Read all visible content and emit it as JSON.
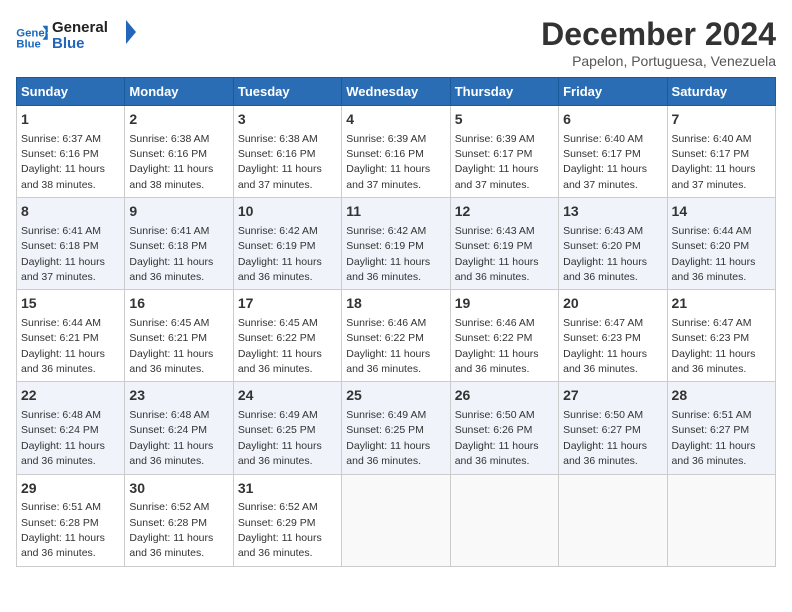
{
  "logo": {
    "line1": "General",
    "line2": "Blue"
  },
  "title": "December 2024",
  "location": "Papelon, Portuguesa, Venezuela",
  "days_header": [
    "Sunday",
    "Monday",
    "Tuesday",
    "Wednesday",
    "Thursday",
    "Friday",
    "Saturday"
  ],
  "weeks": [
    [
      {
        "day": "1",
        "sunrise": "6:37 AM",
        "sunset": "6:16 PM",
        "daylight": "11 hours and 38 minutes."
      },
      {
        "day": "2",
        "sunrise": "6:38 AM",
        "sunset": "6:16 PM",
        "daylight": "11 hours and 38 minutes."
      },
      {
        "day": "3",
        "sunrise": "6:38 AM",
        "sunset": "6:16 PM",
        "daylight": "11 hours and 37 minutes."
      },
      {
        "day": "4",
        "sunrise": "6:39 AM",
        "sunset": "6:16 PM",
        "daylight": "11 hours and 37 minutes."
      },
      {
        "day": "5",
        "sunrise": "6:39 AM",
        "sunset": "6:17 PM",
        "daylight": "11 hours and 37 minutes."
      },
      {
        "day": "6",
        "sunrise": "6:40 AM",
        "sunset": "6:17 PM",
        "daylight": "11 hours and 37 minutes."
      },
      {
        "day": "7",
        "sunrise": "6:40 AM",
        "sunset": "6:17 PM",
        "daylight": "11 hours and 37 minutes."
      }
    ],
    [
      {
        "day": "8",
        "sunrise": "6:41 AM",
        "sunset": "6:18 PM",
        "daylight": "11 hours and 37 minutes."
      },
      {
        "day": "9",
        "sunrise": "6:41 AM",
        "sunset": "6:18 PM",
        "daylight": "11 hours and 36 minutes."
      },
      {
        "day": "10",
        "sunrise": "6:42 AM",
        "sunset": "6:19 PM",
        "daylight": "11 hours and 36 minutes."
      },
      {
        "day": "11",
        "sunrise": "6:42 AM",
        "sunset": "6:19 PM",
        "daylight": "11 hours and 36 minutes."
      },
      {
        "day": "12",
        "sunrise": "6:43 AM",
        "sunset": "6:19 PM",
        "daylight": "11 hours and 36 minutes."
      },
      {
        "day": "13",
        "sunrise": "6:43 AM",
        "sunset": "6:20 PM",
        "daylight": "11 hours and 36 minutes."
      },
      {
        "day": "14",
        "sunrise": "6:44 AM",
        "sunset": "6:20 PM",
        "daylight": "11 hours and 36 minutes."
      }
    ],
    [
      {
        "day": "15",
        "sunrise": "6:44 AM",
        "sunset": "6:21 PM",
        "daylight": "11 hours and 36 minutes."
      },
      {
        "day": "16",
        "sunrise": "6:45 AM",
        "sunset": "6:21 PM",
        "daylight": "11 hours and 36 minutes."
      },
      {
        "day": "17",
        "sunrise": "6:45 AM",
        "sunset": "6:22 PM",
        "daylight": "11 hours and 36 minutes."
      },
      {
        "day": "18",
        "sunrise": "6:46 AM",
        "sunset": "6:22 PM",
        "daylight": "11 hours and 36 minutes."
      },
      {
        "day": "19",
        "sunrise": "6:46 AM",
        "sunset": "6:22 PM",
        "daylight": "11 hours and 36 minutes."
      },
      {
        "day": "20",
        "sunrise": "6:47 AM",
        "sunset": "6:23 PM",
        "daylight": "11 hours and 36 minutes."
      },
      {
        "day": "21",
        "sunrise": "6:47 AM",
        "sunset": "6:23 PM",
        "daylight": "11 hours and 36 minutes."
      }
    ],
    [
      {
        "day": "22",
        "sunrise": "6:48 AM",
        "sunset": "6:24 PM",
        "daylight": "11 hours and 36 minutes."
      },
      {
        "day": "23",
        "sunrise": "6:48 AM",
        "sunset": "6:24 PM",
        "daylight": "11 hours and 36 minutes."
      },
      {
        "day": "24",
        "sunrise": "6:49 AM",
        "sunset": "6:25 PM",
        "daylight": "11 hours and 36 minutes."
      },
      {
        "day": "25",
        "sunrise": "6:49 AM",
        "sunset": "6:25 PM",
        "daylight": "11 hours and 36 minutes."
      },
      {
        "day": "26",
        "sunrise": "6:50 AM",
        "sunset": "6:26 PM",
        "daylight": "11 hours and 36 minutes."
      },
      {
        "day": "27",
        "sunrise": "6:50 AM",
        "sunset": "6:27 PM",
        "daylight": "11 hours and 36 minutes."
      },
      {
        "day": "28",
        "sunrise": "6:51 AM",
        "sunset": "6:27 PM",
        "daylight": "11 hours and 36 minutes."
      }
    ],
    [
      {
        "day": "29",
        "sunrise": "6:51 AM",
        "sunset": "6:28 PM",
        "daylight": "11 hours and 36 minutes."
      },
      {
        "day": "30",
        "sunrise": "6:52 AM",
        "sunset": "6:28 PM",
        "daylight": "11 hours and 36 minutes."
      },
      {
        "day": "31",
        "sunrise": "6:52 AM",
        "sunset": "6:29 PM",
        "daylight": "11 hours and 36 minutes."
      },
      null,
      null,
      null,
      null
    ]
  ]
}
